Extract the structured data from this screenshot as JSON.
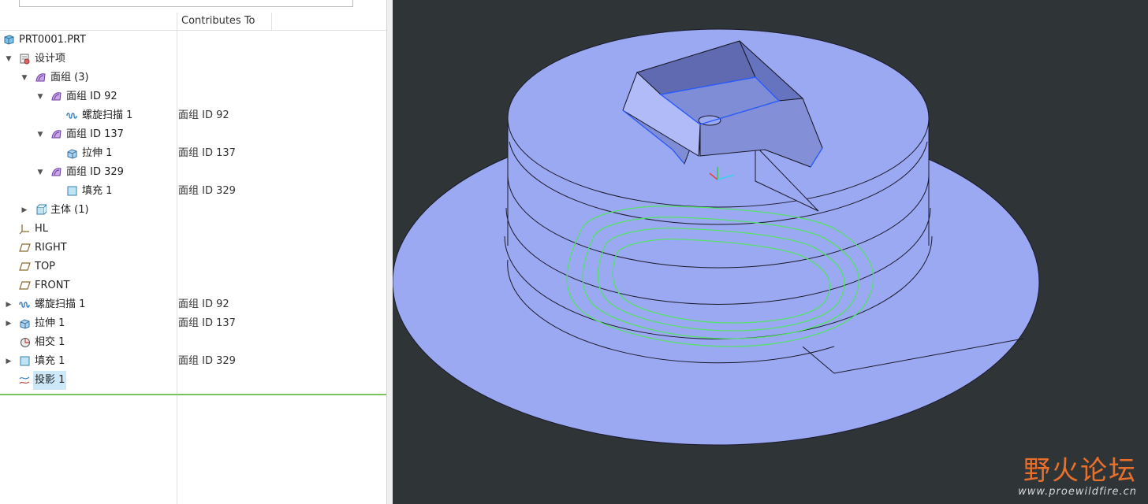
{
  "tree": {
    "column_header": "Contributes To",
    "rows": [
      {
        "label": "PRT0001.PRT",
        "contrib": ""
      },
      {
        "label": "设计项",
        "contrib": ""
      },
      {
        "label": "面组 (3)",
        "contrib": ""
      },
      {
        "label": "面组 ID 92",
        "contrib": ""
      },
      {
        "label": "螺旋扫描 1",
        "contrib": "面组 ID 92"
      },
      {
        "label": "面组 ID 137",
        "contrib": ""
      },
      {
        "label": "拉伸 1",
        "contrib": "面组 ID 137"
      },
      {
        "label": "面组 ID 329",
        "contrib": ""
      },
      {
        "label": "填充 1",
        "contrib": "面组 ID 329"
      },
      {
        "label": "主体 (1)",
        "contrib": ""
      },
      {
        "label": "HL",
        "contrib": ""
      },
      {
        "label": "RIGHT",
        "contrib": ""
      },
      {
        "label": "TOP",
        "contrib": ""
      },
      {
        "label": "FRONT",
        "contrib": ""
      },
      {
        "label": "螺旋扫描 1",
        "contrib": "面组 ID 92"
      },
      {
        "label": "拉伸 1",
        "contrib": "面组 ID 137"
      },
      {
        "label": "相交 1",
        "contrib": ""
      },
      {
        "label": "填充 1",
        "contrib": "面组 ID 329"
      },
      {
        "label": "投影 1",
        "contrib": ""
      }
    ],
    "selected_index": 18
  },
  "icons": {
    "part": "part-icon",
    "design-items": "design-items-icon",
    "quilt": "quilt-icon",
    "helical-sweep": "helical-sweep-icon",
    "extrude": "extrude-icon",
    "fill": "fill-icon",
    "body": "body-icon",
    "csys": "csys-icon",
    "datum-plane": "datum-plane-icon",
    "intersect": "intersect-icon",
    "projection": "projection-icon"
  },
  "colors": {
    "viewport_bg": "#2f3436",
    "surface": "#9ba8f2",
    "surface_dark": "#7f8dd6",
    "curve": "#55e06a",
    "selection": "#cde8f8",
    "insert_line": "#7cc25a",
    "watermark": "#e8702a"
  },
  "watermark": {
    "main": "野火论坛",
    "url": "www.proewildfire.cn"
  }
}
